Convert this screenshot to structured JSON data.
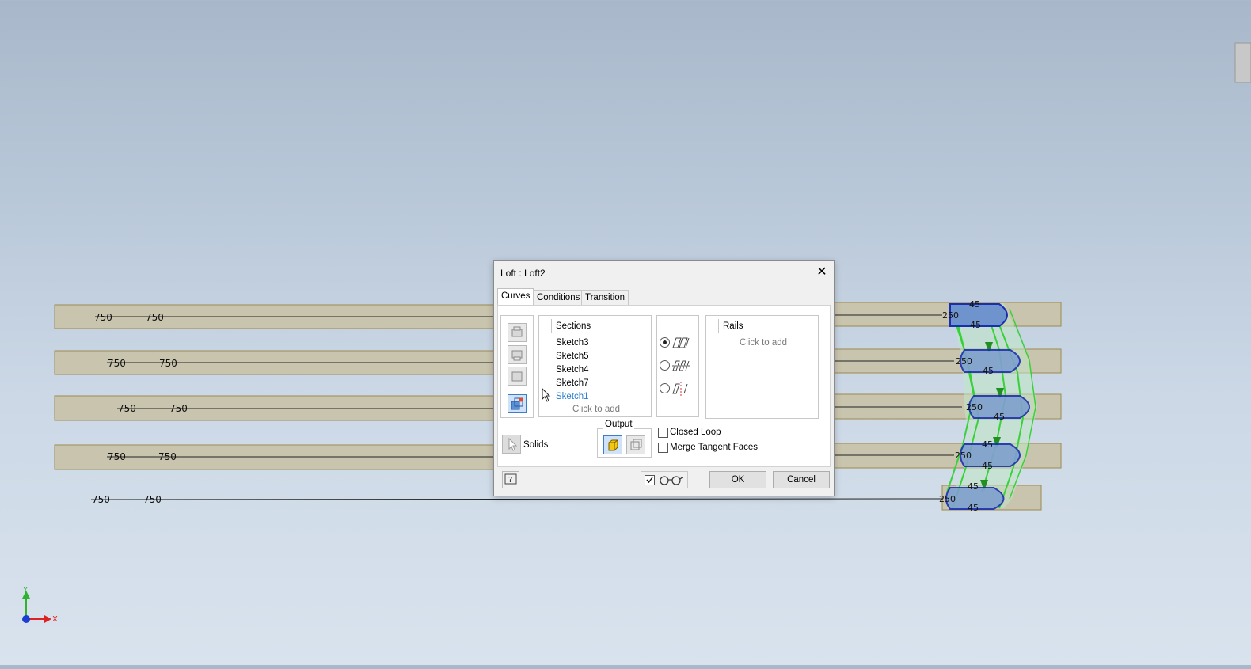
{
  "viewport": {
    "dimension_labels": [
      "750",
      "750",
      "250",
      "45"
    ],
    "axis_labels": {
      "y": "Y",
      "x": "X"
    }
  },
  "dialog": {
    "title": "Loft : Loft2",
    "tabs": [
      {
        "label": "Curves",
        "active": true
      },
      {
        "label": "Conditions",
        "active": false
      },
      {
        "label": "Transition",
        "active": false
      }
    ],
    "sections": {
      "header": "Sections",
      "items": [
        "Sketch3",
        "Sketch5",
        "Sketch4",
        "Sketch7",
        "Sketch1"
      ],
      "selected": "Sketch1",
      "hint": "Click to add"
    },
    "rails": {
      "header": "Rails",
      "hint": "Click to add"
    },
    "solids_label": "Solids",
    "output_label": "Output",
    "options": {
      "closed_loop": {
        "label": "Closed Loop",
        "checked": false
      },
      "merge_tangent_faces": {
        "label": "Merge Tangent Faces",
        "checked": false
      }
    },
    "loft_type_selected": "rails",
    "buttons": {
      "ok": "OK",
      "cancel": "Cancel"
    }
  },
  "colors": {
    "accent": "#0b6fc4",
    "selected_item": "#2b7fd1",
    "sketch_fill": "#c8c3ad",
    "profile_blue": "#6f93cc",
    "green": "#3bd63b"
  }
}
